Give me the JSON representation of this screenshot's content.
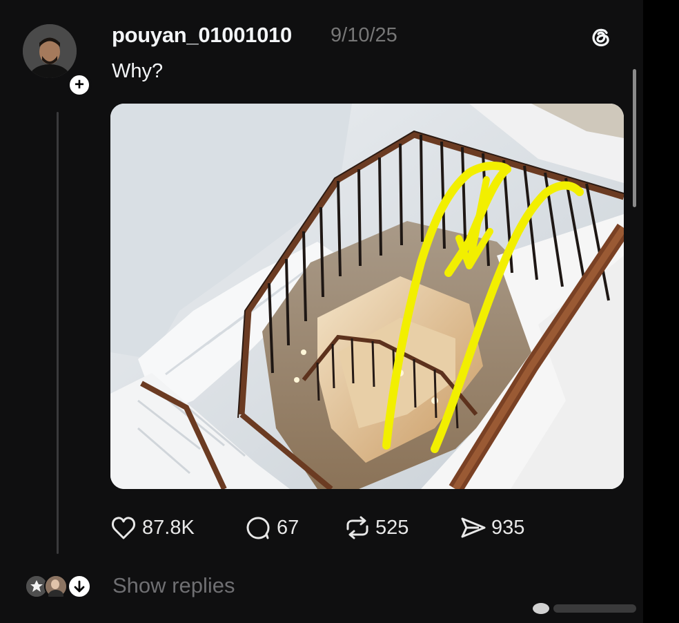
{
  "post": {
    "username": "pouyan_01001010",
    "timestamp": "9/10/25",
    "caption": "Why?",
    "app_icon": "threads-logo-icon",
    "follow_icon": "plus-icon",
    "media_description_icon": "staircase-photo"
  },
  "actions": {
    "likes": "87.8K",
    "comments": "67",
    "reposts": "525",
    "shares": "935"
  },
  "replies": {
    "label": "Show replies"
  },
  "colors": {
    "background": "#0f0f10",
    "text": "#f3f5f7",
    "muted": "#777777",
    "annotation": "#f2ef00",
    "railing": "#6b3b22"
  }
}
